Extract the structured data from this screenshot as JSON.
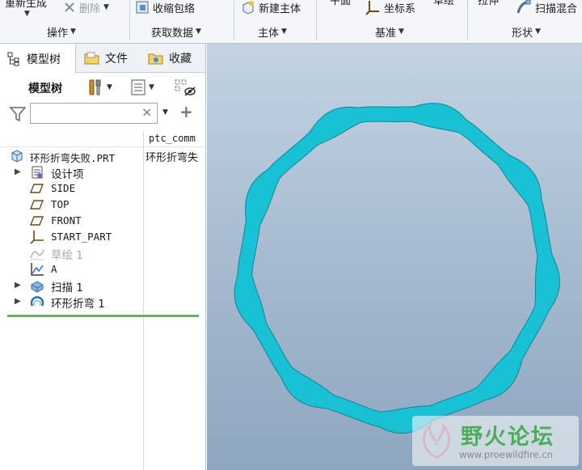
{
  "ribbon": {
    "items": {
      "regenerate": "重新生成",
      "delete": "删除",
      "shrinkwrap": "收缩包络",
      "new_body": "新建主体",
      "plane": "平面",
      "coord_sys": "坐标系",
      "point": "草绘",
      "extrude": "拉伸",
      "swept_blend": "扫描混合"
    },
    "groups": {
      "operations": "操作",
      "get_data": "获取数据",
      "body": "主体",
      "datum": "基准",
      "shapes": "形状"
    }
  },
  "left_panel": {
    "tabs": [
      {
        "label": "模型树"
      },
      {
        "label": "文件"
      },
      {
        "label": "收藏"
      }
    ],
    "tree_title": "模型树",
    "search": {
      "value": "",
      "placeholder": "",
      "clear": "×"
    },
    "column_header": "ptc_comm",
    "rows": [
      {
        "label": "环形折弯失败.PRT",
        "column": "环形折弯失",
        "expandable": false
      },
      {
        "label": "设计项",
        "expandable": true
      },
      {
        "label": "SIDE",
        "expandable": false
      },
      {
        "label": "TOP",
        "expandable": false
      },
      {
        "label": "FRONT",
        "expandable": false
      },
      {
        "label": "START_PART",
        "expandable": false
      },
      {
        "label": "草绘 1",
        "expandable": false,
        "disabled": true
      },
      {
        "label": "A",
        "expandable": false
      },
      {
        "label": "扫描 1",
        "expandable": true
      },
      {
        "label": "环形折弯 1",
        "expandable": true
      }
    ]
  },
  "viewport": {
    "model_color": "#19c1d4",
    "watermark": {
      "title": "野火论坛",
      "url": "www.proewildfire.cn"
    }
  },
  "colors": {
    "accent_green": "#5cb85c",
    "ribbon_bg": "#f4f6f9",
    "viewport_top": "#c3d3e3",
    "viewport_bottom": "#8ea6bf"
  }
}
